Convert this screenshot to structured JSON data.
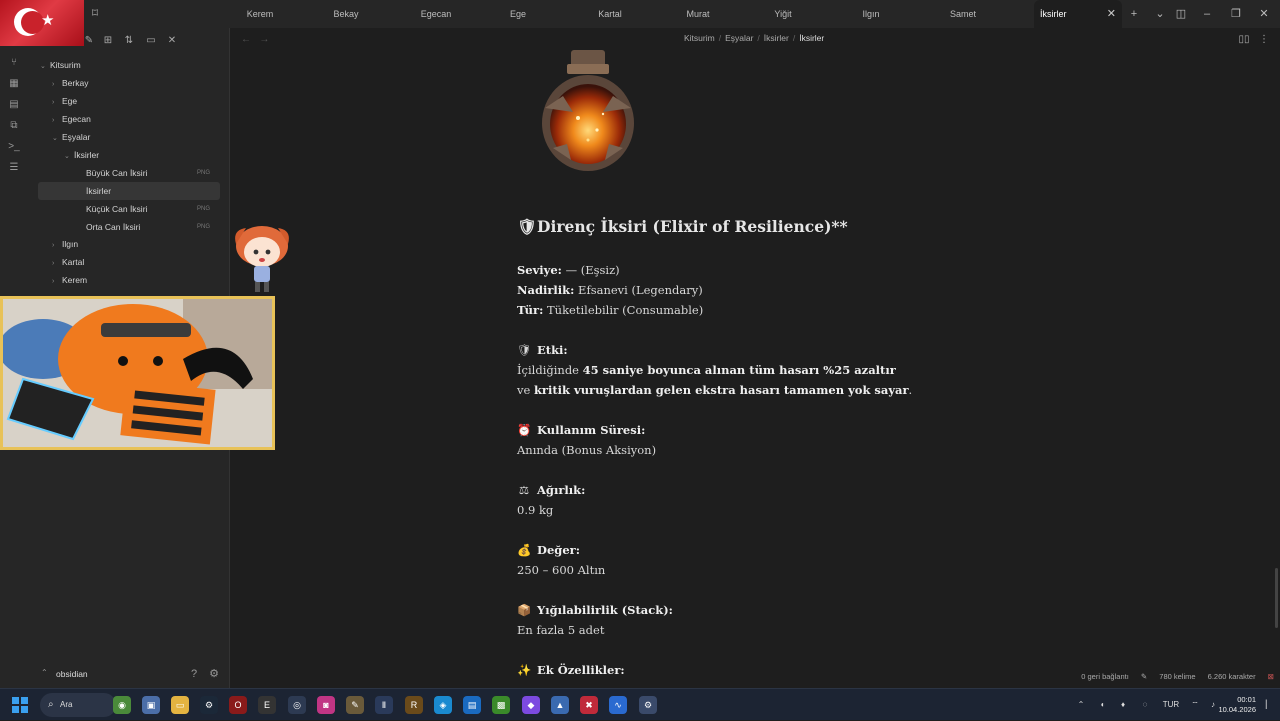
{
  "tabs": [
    "Kerem",
    "Bekay",
    "Egecan",
    "Ege",
    "Kartal",
    "Murat",
    "Yiğit",
    "Ilgın",
    "Samet",
    "İksirler"
  ],
  "active_tab": "İksirler",
  "sidebar": {
    "root": "Kitsurim",
    "items": [
      {
        "label": "Berkay"
      },
      {
        "label": "Ege"
      },
      {
        "label": "Egecan"
      },
      {
        "label": "Eşyalar"
      },
      {
        "label": "İksirler"
      },
      {
        "label": "Büyük Can İksiri",
        "tag": "PNG"
      },
      {
        "label": "İksirler"
      },
      {
        "label": "Küçük Can İksiri",
        "tag": "PNG"
      },
      {
        "label": "Orta Can İksiri",
        "tag": "PNG"
      },
      {
        "label": "Ilgın"
      },
      {
        "label": "Kartal"
      },
      {
        "label": "Kerem"
      }
    ],
    "vault_name": "obsidian"
  },
  "breadcrumb": [
    "Kitsurim",
    "Eşyalar",
    "İksirler",
    "İksirler"
  ],
  "note": {
    "title_icon": "🛡",
    "title": "Direnç İksiri (Elixir of Resilience)**",
    "level_label": "Seviye:",
    "level_value": " — (Eşsiz)",
    "rarity_label": "Nadirlik:",
    "rarity_value": " Efsanevi (Legendary)",
    "type_label": "Tür:",
    "type_value": " Tüketilebilir (Consumable)",
    "effect_icon": "🛡",
    "effect_label": "Etki:",
    "effect_l1_a": "İçildiğinde ",
    "effect_l1_b": "45 saniye boyunca alınan tüm hasarı %25 azaltır",
    "effect_l2_a": "ve ",
    "effect_l2_b": "kritik vuruşlardan gelen ekstra hasarı tamamen yok sayar",
    "effect_l2_c": ".",
    "duration_icon": "⏰",
    "duration_label": "Kullanım Süresi:",
    "duration_value": "Anında (Bonus Aksiyon)",
    "weight_icon": "⚖",
    "weight_label": "Ağırlık:",
    "weight_value": "0.9 kg",
    "value_icon": "💰",
    "value_label": "Değer:",
    "value_value": "250 – 600 Altın",
    "stack_icon": "📦",
    "stack_label": "Yığılabilirlik (Stack):",
    "stack_value": "En fazla 5 adet",
    "extra_icon": "✨",
    "extra_label": "Ek Özellikler:"
  },
  "status": {
    "backlinks": "0 geri bağlantı",
    "words": "780 kelime",
    "chars": "6.260 karakter"
  },
  "taskbar": {
    "search_label": "Ara",
    "language": "TUR",
    "time": "00:01",
    "date": "10.04.2026"
  },
  "colors": {
    "accent": "#8a5cf6",
    "flag_red": "#c9222b",
    "webcam_border": "#e8c258"
  }
}
